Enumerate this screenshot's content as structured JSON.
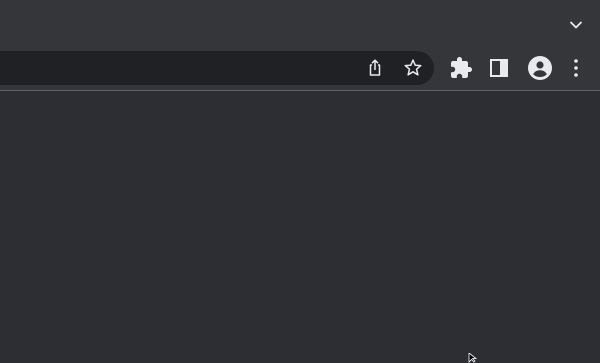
{
  "browser": {
    "theme": "dark",
    "colors": {
      "frame": "#35363a",
      "omnibox": "#202124",
      "content": "#2d2e33",
      "icon": "#e8eaed",
      "separator": "#5f6368"
    }
  },
  "tabstrip": {
    "tab_search_icon": "chevron-down-icon"
  },
  "toolbar": {
    "omnibox": {
      "value": "",
      "icons": [
        "share-icon",
        "star-icon"
      ]
    },
    "actions": [
      "puzzle-icon",
      "side-panel-icon",
      "profile-icon",
      "kebab-menu-icon"
    ]
  }
}
